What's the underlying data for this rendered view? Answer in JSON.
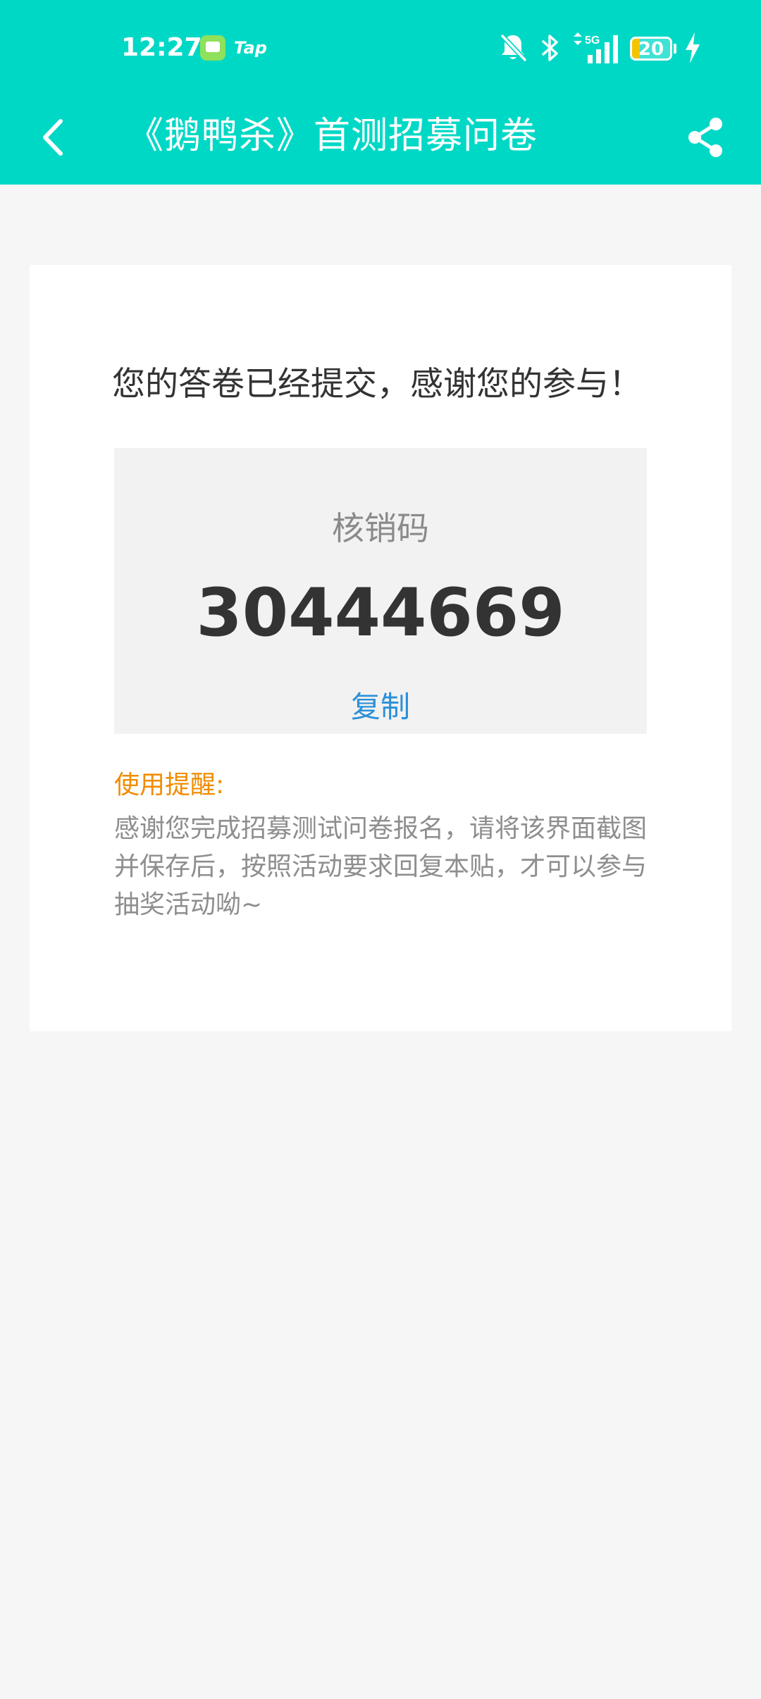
{
  "status_bar": {
    "time": "12:27",
    "app_label": "Tap",
    "network": "5G",
    "battery_level": "20",
    "battery_fraction": 0.2
  },
  "colors": {
    "header_bg": "#00d8c6",
    "page_bg": "#f6f6f6",
    "card_bg": "#ffffff",
    "code_box_bg": "#f2f2f2",
    "accent_link": "#2b90d9",
    "tip_heading": "#f08c00",
    "battery_fill": "#f5c400"
  },
  "icons": {
    "back": "chevron-left-icon",
    "share": "share-icon",
    "mute": "bell-off-icon",
    "bluetooth": "bluetooth-icon",
    "signal": "signal-icon",
    "charging": "bolt-icon"
  },
  "header": {
    "title": "《鹅鸭杀》首测招募问卷"
  },
  "main": {
    "success_message": "您的答卷已经提交，感谢您的参与！",
    "code_label": "核销码",
    "code_value": "30444669",
    "copy_label": "复制",
    "tip_heading": "使用提醒:",
    "tip_body": "感谢您完成招募测试问卷报名，请将该界面截图并保存后，按照活动要求回复本贴，才可以参与抽奖活动呦~"
  }
}
